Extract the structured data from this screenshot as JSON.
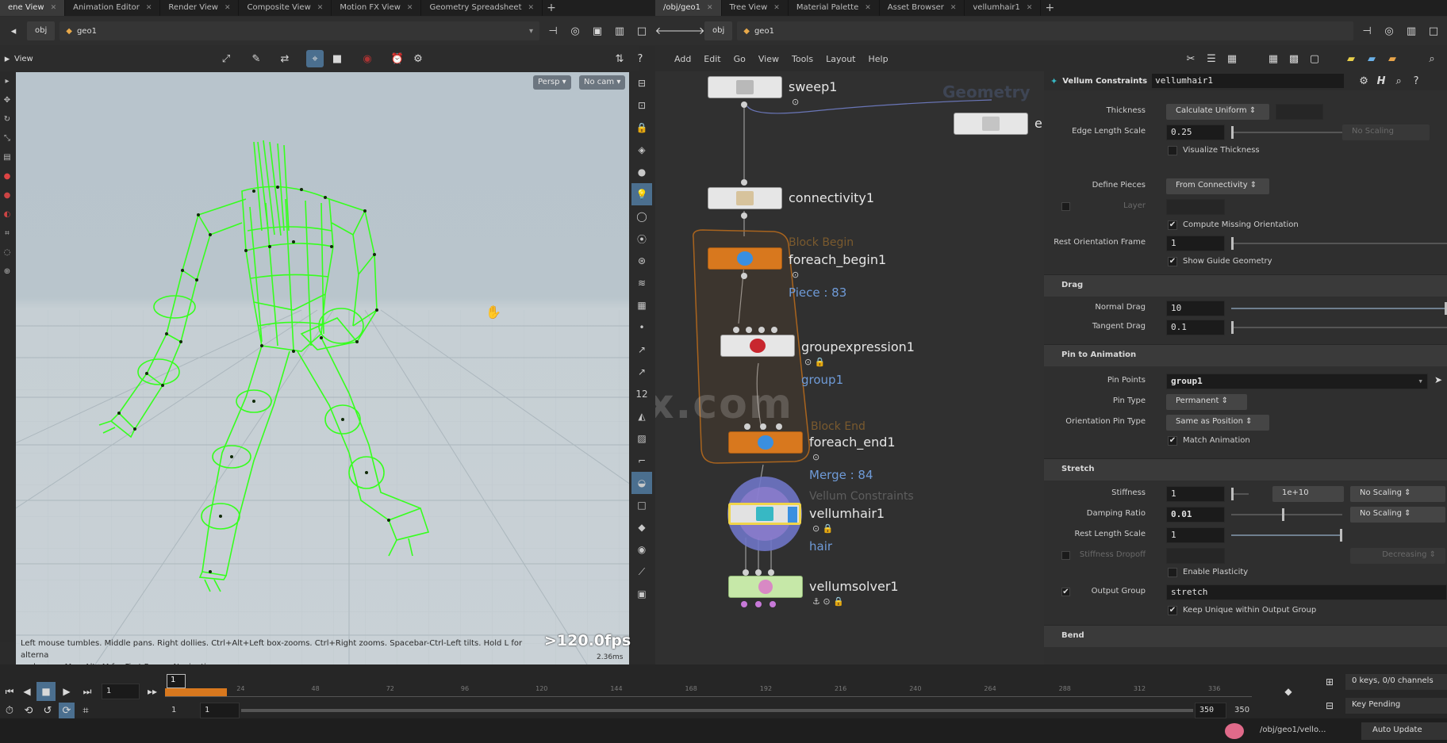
{
  "left_tabs": [
    "ene View",
    "Animation Editor",
    "Render View",
    "Composite View",
    "Motion FX View",
    "Geometry Spreadsheet"
  ],
  "right_tabs": [
    "/obj/geo1",
    "Tree View",
    "Material Palette",
    "Asset Browser",
    "vellumhair1"
  ],
  "left_path": {
    "obj": "obj",
    "geo": "geo1"
  },
  "right_path": {
    "obj": "obj",
    "geo": "geo1"
  },
  "viewport": {
    "title": "View",
    "persp": "Persp",
    "cam": "No cam",
    "hint_line1": "Left mouse tumbles. Middle pans. Right dollies. Ctrl+Alt+Left box-zooms. Ctrl+Right zooms. Spacebar-Ctrl-Left tilts. Hold L for alterna",
    "hint_line2": "and zoom.     M or Alt+M for First Person Navigation.",
    "fps": ">120.0fps",
    "ms": "2.36ms"
  },
  "menu": [
    "Add",
    "Edit",
    "Go",
    "View",
    "Tools",
    "Layout",
    "Help"
  ],
  "network": {
    "watermark": "Geometry",
    "nodes": {
      "sweep": "sweep1",
      "connectivity": "connectivity1",
      "block_begin_caption": "Block Begin",
      "foreach_begin": "foreach_begin1",
      "piece": "Piece : 83",
      "groupexpression": "groupexpression1",
      "group": "group1",
      "block_end_caption": "Block End",
      "foreach_end": "foreach_end1",
      "merge": "Merge : 84",
      "vellum_caption": "Vellum Constraints",
      "vellumhair": "vellumhair1",
      "hair": "hair",
      "vellumsolver": "vellumsolver1",
      "side_node": "e"
    },
    "site_watermark": "iiivfx.com"
  },
  "params": {
    "node_type": "Vellum Constraints",
    "node_name": "vellumhair1",
    "thickness_label": "Thickness",
    "thickness_value": "Calculate Uniform",
    "edge_length_scale_label": "Edge Length Scale",
    "edge_length_scale_value": "0.25",
    "edge_no_scaling": "No Scaling",
    "visualize_thickness": "Visualize Thickness",
    "define_pieces_label": "Define Pieces",
    "define_pieces_value": "From Connectivity",
    "layer_label": "Layer",
    "compute_missing_orientation": "Compute Missing Orientation",
    "rest_orientation_frame_label": "Rest Orientation Frame",
    "rest_orientation_frame_value": "1",
    "show_guide_geometry": "Show Guide Geometry",
    "drag_section": "Drag",
    "normal_drag_label": "Normal Drag",
    "normal_drag_value": "10",
    "tangent_drag_label": "Tangent Drag",
    "tangent_drag_value": "0.1",
    "pin_section": "Pin to Animation",
    "pin_points_label": "Pin Points",
    "pin_points_value": "group1",
    "pin_type_label": "Pin Type",
    "pin_type_value": "Permanent",
    "orientation_pin_type_label": "Orientation Pin Type",
    "orientation_pin_type_value": "Same as Position",
    "match_animation": "Match Animation",
    "stretch_section": "Stretch",
    "stiffness_label": "Stiffness",
    "stiffness_value": "1",
    "stiffness_exp": "1e+10",
    "stiffness_scaling": "No Scaling",
    "damping_label": "Damping Ratio",
    "damping_value": "0.01",
    "damping_scaling": "No Scaling",
    "rest_length_label": "Rest Length Scale",
    "rest_length_value": "1",
    "stiffness_dropoff_label": "Stiffness Dropoff",
    "stiffness_dropoff_mode": "Decreasing",
    "enable_plasticity": "Enable Plasticity",
    "output_group_label": "Output Group",
    "output_group_value": "stretch",
    "keep_unique": "Keep Unique within Output Group",
    "bend_section": "Bend"
  },
  "timeline": {
    "current_frame": "1",
    "frame_marker": "1",
    "ticks": [
      "24",
      "48",
      "72",
      "96",
      "120",
      "144",
      "168",
      "192",
      "216",
      "240",
      "264",
      "288",
      "312",
      "336"
    ],
    "range_start": "1",
    "range_start2": "1",
    "range_end": "350",
    "range_end2": "350",
    "keys_channels": "0 keys, 0/0 channels",
    "key_pending": "Key Pending",
    "auto_update": "Auto Update",
    "status_path": "/obj/geo1/vello..."
  },
  "colors": {
    "wire": "#3cff2a",
    "node_orange": "#d8781e",
    "node_blue": "#3a8fe0",
    "selected_outline": "#f0d44a"
  }
}
